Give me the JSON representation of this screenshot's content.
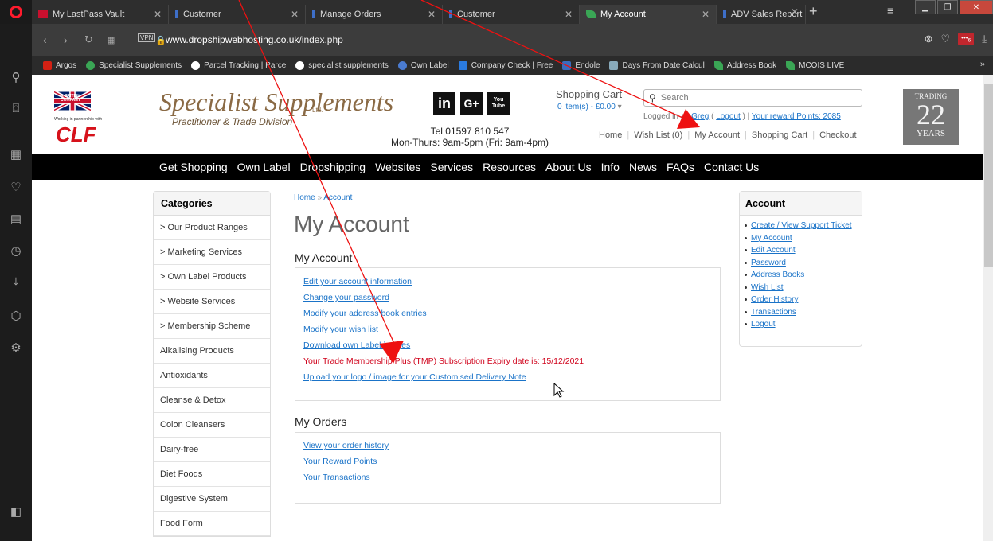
{
  "browser": {
    "tabs": [
      {
        "label": "My LastPass Vault",
        "active": false
      },
      {
        "label": "Customer",
        "active": false
      },
      {
        "label": "Manage Orders",
        "active": false
      },
      {
        "label": "Customer",
        "active": false
      },
      {
        "label": "My Account",
        "active": true
      },
      {
        "label": "ADV Sales Report",
        "active": false
      }
    ],
    "url_host": "www.dropshipwebhosting.co.uk",
    "url_path": "/index.php",
    "vpn_label": "VPN",
    "bookmarks": [
      "Argos",
      "Specialist Supplements",
      "Parcel Tracking | Parce",
      "specialist supplements",
      "Own Label",
      "Company Check | Free",
      "Endole",
      "Days From Date Calcul",
      "Address Book",
      "MCOIS LIVE"
    ],
    "badge_count": "6"
  },
  "header": {
    "partner_text": "Working in partnership with",
    "brand_logo_text": "CLF",
    "company_badge": "A BRITISH COMPANY",
    "brand_name": "Specialist Supplements",
    "brand_ltd": "Ltd.",
    "brand_sub": "Practitioner & Trade Division",
    "social": [
      "in",
      "G+",
      "You Tube"
    ],
    "tel": "Tel 01597 810 547",
    "hours": "Mon-Thurs: 9am-5pm (Fri: 9am-4pm)",
    "cart_title": "Shopping Cart",
    "cart_contents": "0 item(s) - £0.00",
    "search_placeholder": "Search",
    "logged_prefix": "Logged in as",
    "user": "Greg",
    "logout": "Logout",
    "reward": "Your reward Points: 2085",
    "toplinks": [
      "Home",
      "Wish List (0)",
      "My Account",
      "Shopping Cart",
      "Checkout"
    ],
    "trading_top": "TRADING",
    "trading_num": "22",
    "trading_bottom": "YEARS"
  },
  "menu": [
    "Get Shopping",
    "Own Label",
    "Dropshipping",
    "Websites",
    "Services",
    "Resources",
    "About Us",
    "Info",
    "News",
    "FAQs",
    "Contact Us"
  ],
  "categories": {
    "title": "Categories",
    "items": [
      "> Our Product Ranges",
      "> Marketing Services",
      "> Own Label Products",
      "> Website Services",
      "> Membership Scheme",
      "Alkalising Products",
      "Antioxidants",
      "Cleanse & Detox",
      "Colon Cleansers",
      "Dairy-free",
      "Diet Foods",
      "Digestive System",
      "Food Form"
    ]
  },
  "main": {
    "breadcrumb_home": "Home",
    "breadcrumb_sep": "»",
    "breadcrumb_current": "Account",
    "title": "My Account",
    "account_heading": "My Account",
    "account_links": [
      "Edit your account information",
      "Change your password",
      "Modify your address book entries",
      "Modify your wish list",
      "Download own Label images"
    ],
    "tmp_notice": "Your Trade Membership Plus (TMP) Subscription Expiry date is: 15/12/2021",
    "upload_link": "Upload your logo / image for your Customised Delivery Note",
    "orders_heading": "My Orders",
    "orders_links": [
      "View your order history",
      "Your Reward Points",
      "Your Transactions"
    ]
  },
  "account_box": {
    "title": "Account",
    "links": [
      "Create / View Support Ticket",
      "My Account",
      "Edit Account",
      "Password",
      "Address Books",
      "Wish List",
      "Order History",
      "Transactions",
      "Logout"
    ]
  },
  "annotation_color": "#ee1111"
}
